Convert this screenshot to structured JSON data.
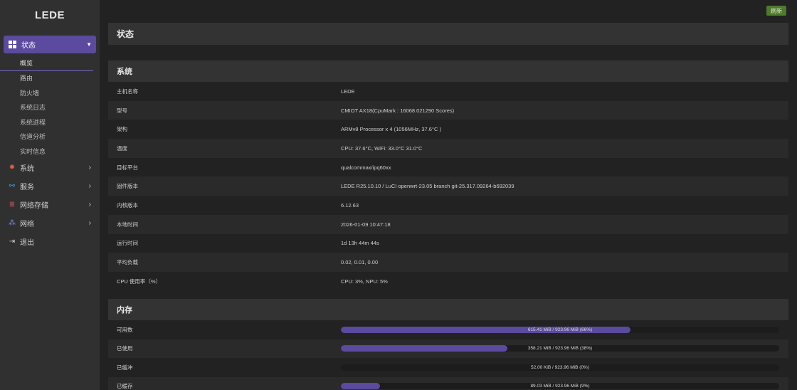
{
  "brand": "LEDE",
  "sidebar": {
    "active": {
      "label": "状态",
      "caret": "⌄"
    },
    "sub_items": [
      "概览",
      "路由",
      "防火墙",
      "系统日志",
      "系统进程",
      "信道分析",
      "实时信息"
    ],
    "items": [
      {
        "label": "系统",
        "icon": "gear-icon",
        "arrow": "›"
      },
      {
        "label": "服务",
        "icon": "link-icon",
        "arrow": "›"
      },
      {
        "label": "网络存储",
        "icon": "database-icon",
        "arrow": "›"
      },
      {
        "label": "网络",
        "icon": "network-icon",
        "arrow": "›"
      },
      {
        "label": "退出",
        "icon": "logout-icon",
        "arrow": ""
      }
    ]
  },
  "header": {
    "refresh_label": "刷新"
  },
  "page": {
    "title": "状态"
  },
  "system": {
    "title": "系统",
    "rows": [
      {
        "key": "主机名称",
        "value": "LEDE"
      },
      {
        "key": "型号",
        "value": "CMIOT AX18(CpuMark : 16068.021290 Scores)"
      },
      {
        "key": "架构",
        "value": "ARMv8 Processor x 4 (1056MHz, 37.6°C )"
      },
      {
        "key": "温度",
        "value": "CPU: 37.6°C, WiFi: 33.0°C 31.0°C"
      },
      {
        "key": "目标平台",
        "value": "qualcommax/ipq60xx"
      },
      {
        "key": "固件版本",
        "value": "LEDE R25.10.10 / LuCI openwrt-23.05 branch git-25.317.09264-b692039"
      },
      {
        "key": "内核版本",
        "value": "6.12.63"
      },
      {
        "key": "本地时间",
        "value": "2026-01-09 10:47:18"
      },
      {
        "key": "运行时间",
        "value": "1d 13h 44m 44s"
      },
      {
        "key": "平均负载",
        "value": "0.02, 0.01, 0.00"
      },
      {
        "key": "CPU 使用率（%）",
        "value": "CPU: 3%, NPU: 5%"
      }
    ]
  },
  "memory": {
    "title": "内存",
    "rows": [
      {
        "key": "可用数",
        "text": "615.41 MiB / 923.96 MiB (66%)",
        "percent": 66
      },
      {
        "key": "已使用",
        "text": "358.21 MiB / 923.96 MiB (38%)",
        "percent": 38
      },
      {
        "key": "已缓冲",
        "text": "52.00 KiB / 923.96 MiB (0%)",
        "percent": 0
      },
      {
        "key": "已缓存",
        "text": "89.03 MiB / 923.96 MiB (9%)",
        "percent": 9
      }
    ]
  },
  "colors": {
    "accent": "#5b4a9e",
    "refresh": "#4e7a2c",
    "gear": "#e0603a",
    "link": "#3aa0e0",
    "db": "#e05a6a",
    "net": "#7b8ae0"
  }
}
